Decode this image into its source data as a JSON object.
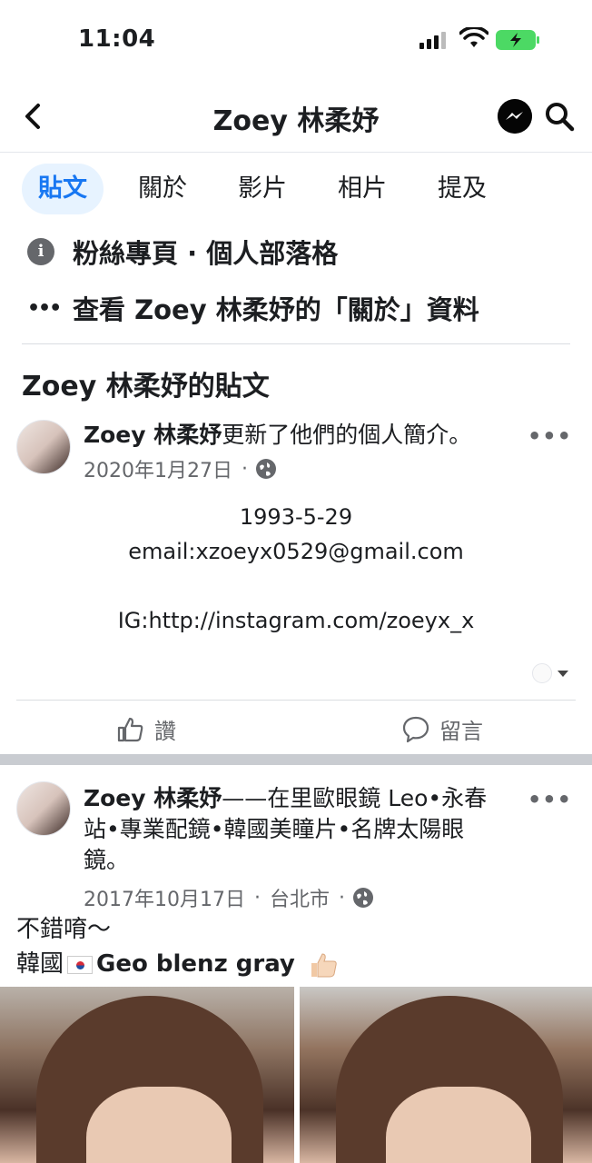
{
  "status_bar": {
    "time": "11:04",
    "icons": [
      "signal-icon",
      "wifi-icon",
      "battery-charging-icon"
    ]
  },
  "header": {
    "title": "Zoey 林柔妤",
    "icons": [
      "back-arrow-icon",
      "messenger-icon",
      "search-icon"
    ]
  },
  "tabs": [
    {
      "label": "貼文",
      "active": true
    },
    {
      "label": "關於",
      "active": false
    },
    {
      "label": "影片",
      "active": false
    },
    {
      "label": "相片",
      "active": false
    },
    {
      "label": "提及",
      "active": false
    }
  ],
  "info": {
    "category": "粉絲專頁 · 個人部落格",
    "see_about": "查看 Zoey 林柔妤的「關於」資料"
  },
  "section_title": "Zoey 林柔妤的貼文",
  "posts": [
    {
      "author": "Zoey 林柔妤",
      "action": "更新了他們的個人簡介。",
      "date": "2020年1月27日",
      "separator": "·",
      "body_lines": [
        "1993-5-29",
        "email:xzoeyx0529@gmail.com",
        "",
        "IG:http://instagram.com/zoeyx_x"
      ]
    },
    {
      "author": "Zoey 林柔妤",
      "action_line1": "——在里歐眼鏡 Leo•永春",
      "action_line2": "站•專業配鏡•韓國美瞳片•名牌太陽眼",
      "action_line3": "鏡。",
      "date": "2017年10月17日",
      "location": "台北市",
      "separator": "·",
      "text_line1": "不錯唷～",
      "text_line2_prefix": "韓國",
      "text_line2_suffix": "Geo blenz gray"
    }
  ],
  "actions": {
    "like": "讚",
    "comment": "留言"
  },
  "more_label": "•••"
}
